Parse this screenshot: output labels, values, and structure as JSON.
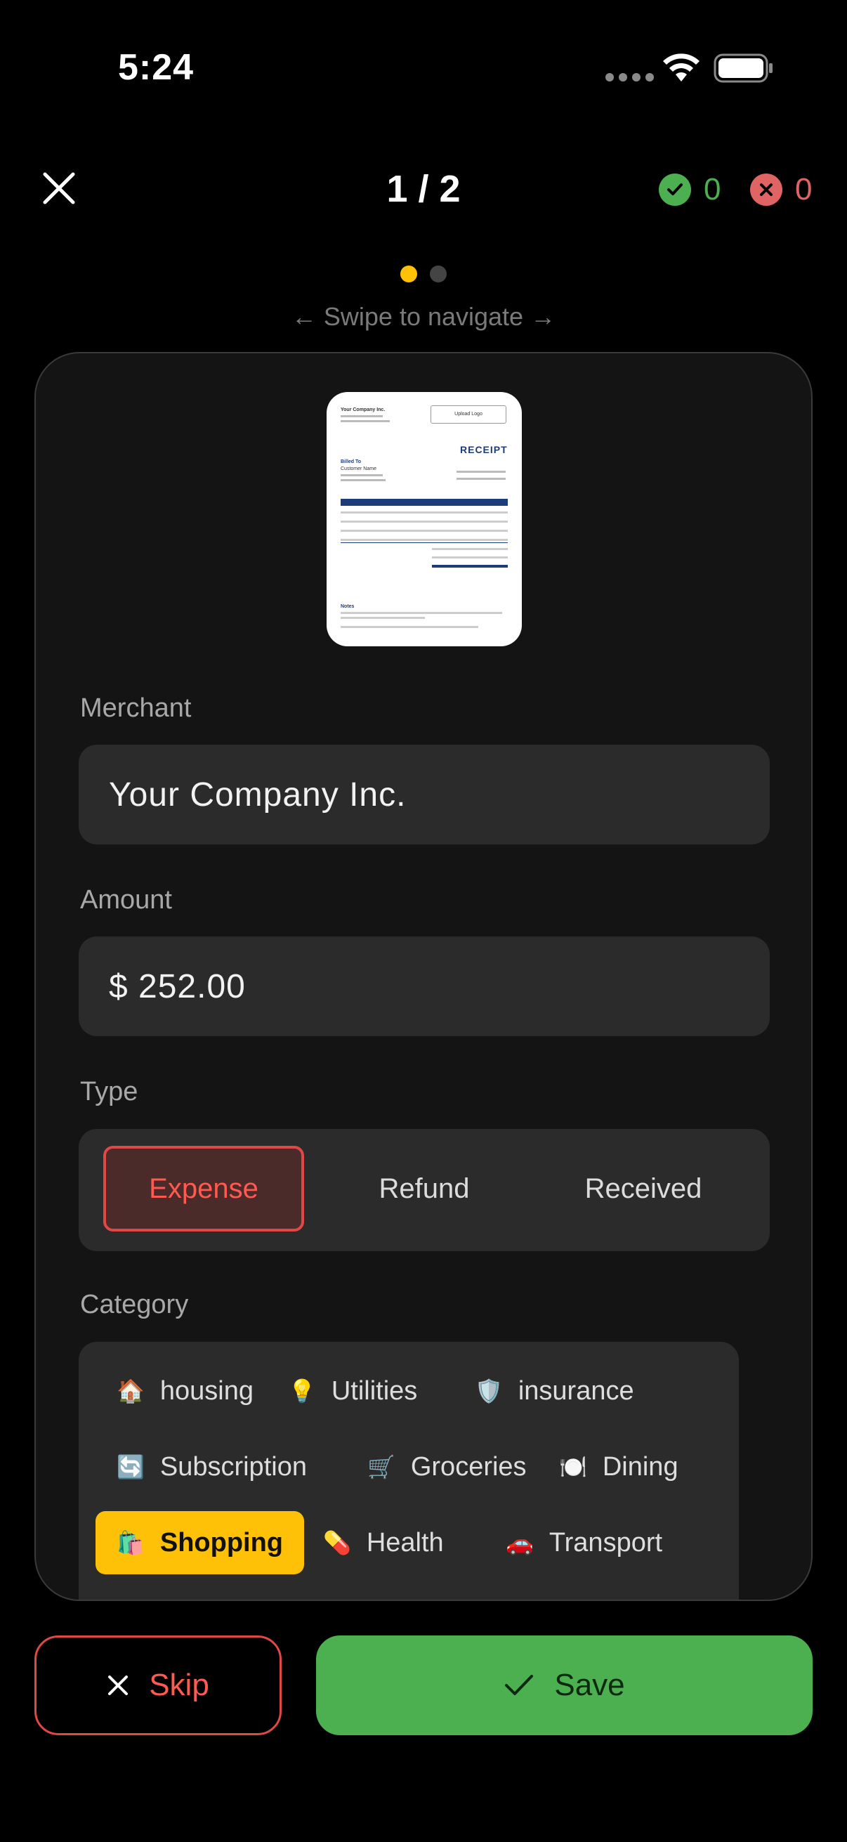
{
  "status": {
    "time": "5:24"
  },
  "header": {
    "counter": "1 / 2",
    "approved_count": "0",
    "rejected_count": "0"
  },
  "pager": {
    "hint": "← Swipe to navigate →"
  },
  "receipt_thumb": {
    "company": "Your Company Inc.",
    "upload_logo": "Upload Logo",
    "heading": "RECEIPT",
    "billed_to": "Billed To",
    "customer": "Customer Name",
    "notes": "Notes"
  },
  "form": {
    "merchant_label": "Merchant",
    "merchant_value": "Your Company Inc.",
    "amount_label": "Amount",
    "amount_value": "$ 252.00",
    "type_label": "Type",
    "types": [
      "Expense",
      "Refund",
      "Received"
    ],
    "selected_type": "Expense",
    "category_label": "Category",
    "categories": [
      {
        "icon": "🏠",
        "label": "housing"
      },
      {
        "icon": "💡",
        "label": "Utilities"
      },
      {
        "icon": "🛡️",
        "label": "insurance"
      },
      {
        "icon": "🔄",
        "label": "Subscription"
      },
      {
        "icon": "🛒",
        "label": "Groceries"
      },
      {
        "icon": "🍽️",
        "label": "Dining"
      },
      {
        "icon": "🛍️",
        "label": "Shopping"
      },
      {
        "icon": "💊",
        "label": "Health"
      },
      {
        "icon": "🚗",
        "label": "Transport"
      }
    ],
    "selected_category": "Shopping"
  },
  "actions": {
    "skip_label": "Skip",
    "save_label": "Save"
  },
  "colors": {
    "accent_yellow": "#ffc107",
    "success_green": "#4caf50",
    "danger_red": "#e04848",
    "card_bg": "#141414"
  }
}
